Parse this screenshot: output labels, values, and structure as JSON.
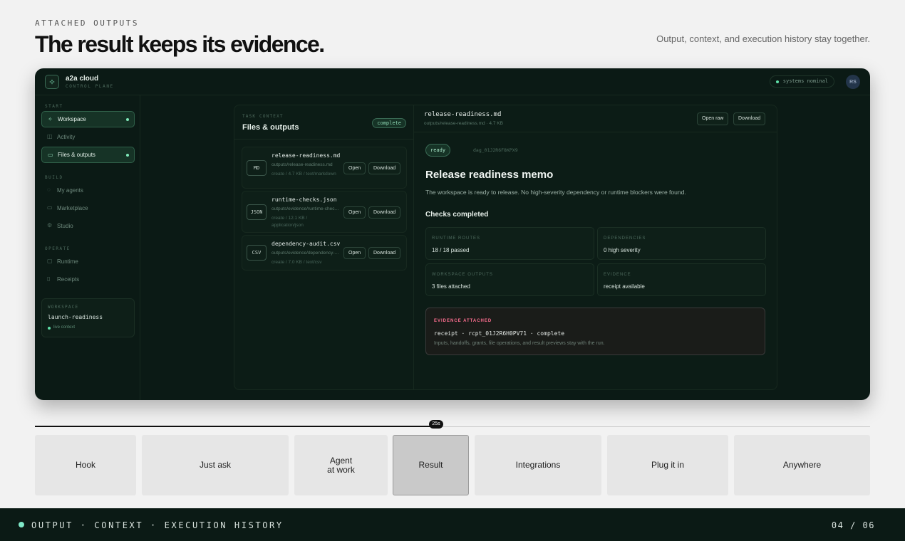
{
  "header": {
    "eyebrow": "ATTACHED OUTPUTS",
    "title": "The result keeps its evidence.",
    "subtitle": "Output, context, and execution history stay together."
  },
  "app": {
    "brand": "a2a cloud",
    "brand_sub": "CONTROL PLANE",
    "status": "systems nominal",
    "avatar": "RS"
  },
  "sidebar": {
    "sections": [
      {
        "label": "START",
        "items": [
          {
            "label": "Workspace",
            "icon": "sparkle-icon",
            "active": true
          },
          {
            "label": "Activity",
            "icon": "activity-icon",
            "active": false
          },
          {
            "label": "Files & outputs",
            "icon": "folder-icon",
            "active": true
          }
        ]
      },
      {
        "label": "BUILD",
        "items": [
          {
            "label": "My agents",
            "icon": "agent-icon",
            "active": false
          },
          {
            "label": "Marketplace",
            "icon": "store-icon",
            "active": false
          },
          {
            "label": "Studio",
            "icon": "gear-icon",
            "active": false
          }
        ]
      },
      {
        "label": "OPERATE",
        "items": [
          {
            "label": "Runtime",
            "icon": "runtime-icon",
            "active": false
          },
          {
            "label": "Receipts",
            "icon": "receipt-icon",
            "active": false
          }
        ]
      }
    ],
    "workspace_card": {
      "label": "WORKSPACE",
      "name": "launch-readiness",
      "status": "live context"
    }
  },
  "files_panel": {
    "label": "TASK CONTEXT",
    "title": "Files & outputs",
    "status": "complete",
    "files": [
      {
        "badge": "MD",
        "name": "release-readiness.md",
        "path": "outputs/release-readiness.md",
        "meta": "create / 4.7 KB / text/markdown",
        "open": "Open",
        "download": "Download"
      },
      {
        "badge": "JSON",
        "name": "runtime-checks.json",
        "path": "outputs/evidence/runtime-checks.json",
        "meta": "create / 12.1 KB / application/json",
        "open": "Open",
        "download": "Download"
      },
      {
        "badge": "CSV",
        "name": "dependency-audit.csv",
        "path": "outputs/evidence/dependency-audit.csv",
        "meta": "create / 7.0 KB / text/csv",
        "open": "Open",
        "download": "Download"
      }
    ]
  },
  "preview": {
    "file_name": "release-readiness.md",
    "file_path": "outputs/release-readiness.md · 4.7 KB",
    "open_raw": "Open raw",
    "download": "Download",
    "status": "ready",
    "dag": "dag_01J2R6F8KPX9",
    "title": "Release readiness memo",
    "body": "The workspace is ready to release. No high-severity dependency or runtime blockers were found.",
    "checks_title": "Checks completed",
    "checks": [
      {
        "label": "RUNTIME ROUTES",
        "value": "18 / 18 passed"
      },
      {
        "label": "DEPENDENCIES",
        "value": "0 high severity"
      },
      {
        "label": "WORKSPACE OUTPUTS",
        "value": "3 files attached"
      },
      {
        "label": "EVIDENCE",
        "value": "receipt available"
      }
    ],
    "evidence": {
      "label": "EVIDENCE ATTACHED",
      "receipt": "receipt · rcpt_01J2R6H0PV71 · complete",
      "description": "Inputs, handoffs, grants, file operations, and result previews stay with the run."
    }
  },
  "timeline": {
    "time": "25s",
    "progress": 0.48,
    "chapters": [
      {
        "label": "Hook",
        "active": false
      },
      {
        "label": "Just ask",
        "active": false
      },
      {
        "label": "Agent\nat work",
        "active": false
      },
      {
        "label": "Result",
        "active": true
      },
      {
        "label": "Integrations",
        "active": false
      },
      {
        "label": "Plug it in",
        "active": false
      },
      {
        "label": "Anywhere",
        "active": false
      }
    ]
  },
  "footer": {
    "text": "OUTPUT · CONTEXT · EXECUTION HISTORY",
    "page": "04 / 06"
  }
}
